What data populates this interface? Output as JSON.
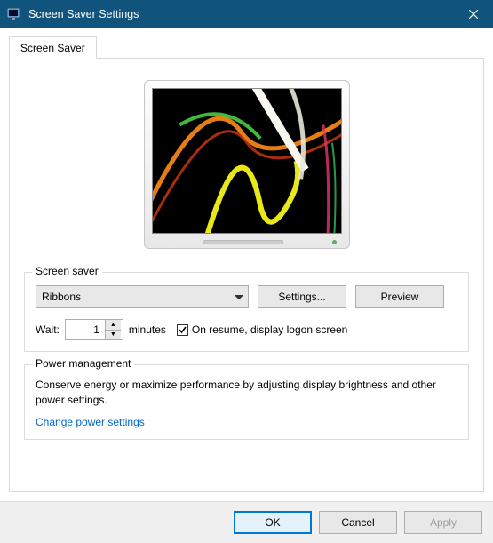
{
  "titlebar": {
    "title": "Screen Saver Settings"
  },
  "tab": {
    "label": "Screen Saver"
  },
  "screensaver_group": {
    "label": "Screen saver",
    "selected": "Ribbons",
    "settings_button": "Settings...",
    "preview_button": "Preview",
    "wait_label": "Wait:",
    "wait_value": "1",
    "wait_unit": "minutes",
    "resume_checkbox_label": "On resume, display logon screen",
    "resume_checked": true
  },
  "power_group": {
    "label": "Power management",
    "text": "Conserve energy or maximize performance by adjusting display brightness and other power settings.",
    "link": "Change power settings"
  },
  "footer": {
    "ok": "OK",
    "cancel": "Cancel",
    "apply": "Apply"
  }
}
